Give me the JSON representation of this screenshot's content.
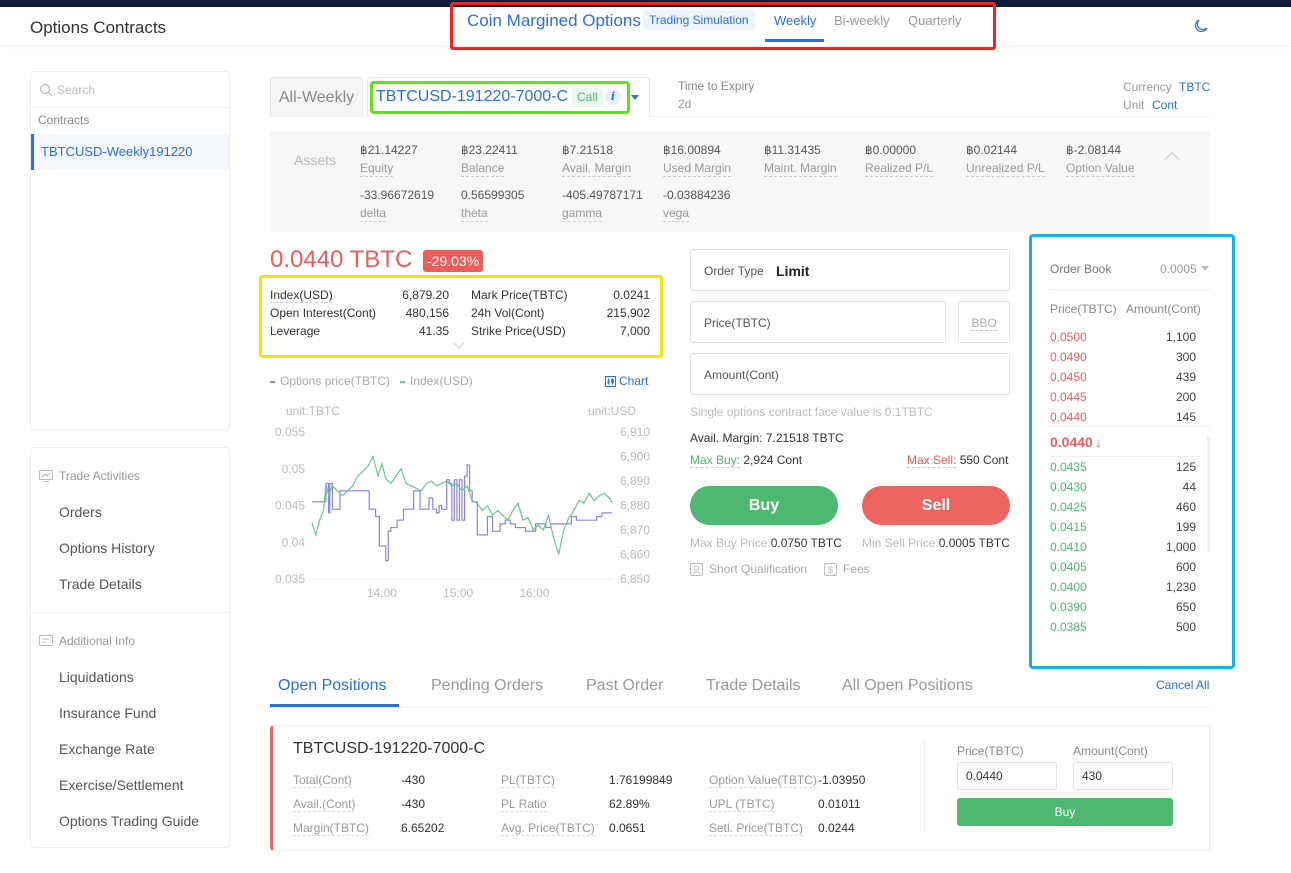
{
  "header": {
    "page_title": "Options Contracts",
    "brand": "Coin Margined Options",
    "badge": "Trading Simulation",
    "tabs": [
      {
        "label": "Weekly",
        "active": true
      },
      {
        "label": "Bi-weekly",
        "active": false
      },
      {
        "label": "Quarterly",
        "active": false
      }
    ],
    "theme_icon": "moon-icon"
  },
  "sidebar": {
    "search_placeholder": "Search",
    "contracts_label": "Contracts",
    "contracts": [
      "TBTCUSD-Weekly191220"
    ],
    "trade_activities": {
      "title": "Trade Activities",
      "items": [
        "Orders",
        "Options History",
        "Trade Details"
      ]
    },
    "additional_info": {
      "title": "Additional Info",
      "items": [
        "Liquidations",
        "Insurance Fund",
        "Exchange Rate",
        "Exercise/Settlement",
        "Options Trading Guide"
      ]
    }
  },
  "selector": {
    "all_tab": "All-Weekly",
    "contract": "TBTCUSD-191220-7000-C",
    "type_badge": "Call",
    "info_icon": "i",
    "time_to_expiry_label": "Time to Expiry",
    "time_to_expiry": "2d",
    "currency_label": "Currency",
    "currency": "TBTC",
    "unit_label": "Unit",
    "unit": "Cont"
  },
  "assets": {
    "title": "Assets",
    "row1": [
      {
        "value": "฿21.14227",
        "label": "Equity"
      },
      {
        "value": "฿23.22411",
        "label": "Balance"
      },
      {
        "value": "฿7.21518",
        "label": "Avail. Margin"
      },
      {
        "value": "฿16.00894",
        "label": "Used Margin"
      },
      {
        "value": "฿11.31435",
        "label": "Maint. Margin"
      },
      {
        "value": "฿0.00000",
        "label": "Realized P/L"
      },
      {
        "value": "฿0.02144",
        "label": "Unrealized P/L"
      },
      {
        "value": "฿-2.08144",
        "label": "Option Value"
      }
    ],
    "row2": [
      {
        "value": "-33.96672619",
        "label": "delta"
      },
      {
        "value": "0.56599305",
        "label": "theta"
      },
      {
        "value": "-405.49787171",
        "label": "gamma"
      },
      {
        "value": "-0.03884236",
        "label": "vega"
      }
    ]
  },
  "ticker": {
    "last_price": "0.0440 TBTC",
    "change": "-29.03%",
    "stats_left": [
      {
        "label": "Index(USD)",
        "value": "6,879.20"
      },
      {
        "label": "Open Interest(Cont)",
        "value": "480,156"
      },
      {
        "label": "Leverage",
        "value": "41.35"
      }
    ],
    "stats_right": [
      {
        "label": "Mark Price(TBTC)",
        "value": "0.0241"
      },
      {
        "label": "24h Vol(Cont)",
        "value": "215,902"
      },
      {
        "label": "Strike Price(USD)",
        "value": "7,000"
      }
    ]
  },
  "chart_link": "Chart",
  "chart_data": {
    "type": "line",
    "title": "",
    "legend": [
      "Options price(TBTC)",
      "Index(USD)"
    ],
    "legend_position": "top-left",
    "left_unit": "unit:TBTC",
    "right_unit": "unit:USD",
    "x_ticks": [
      "14:00",
      "15:00",
      "16:00"
    ],
    "x_range": [
      "13:05",
      "17:00"
    ],
    "y_left_ticks": [
      "0.055",
      "0.05",
      "0.045",
      "0.04",
      "0.035"
    ],
    "y_left_range": [
      0.035,
      0.055
    ],
    "y_right_ticks": [
      "6,910",
      "6,900",
      "6,890",
      "6,880",
      "6,870",
      "6,860",
      "6,850"
    ],
    "y_right_range": [
      6850,
      6910
    ],
    "colors": {
      "options": "#8b85e0",
      "index": "#6cc68a"
    },
    "series": [
      {
        "name": "Options price(TBTC)",
        "axis": "left",
        "x_min": [
          0,
          9,
          11,
          12,
          13,
          14,
          16,
          18,
          22,
          25,
          30,
          40,
          45,
          50,
          53,
          58,
          60,
          62,
          65,
          67,
          70,
          72,
          76,
          80,
          85,
          88,
          92,
          95,
          98,
          100,
          102,
          104,
          106,
          108,
          110,
          112,
          114,
          116,
          118,
          120,
          122,
          124,
          126,
          130,
          134,
          138,
          142,
          144,
          148,
          152,
          156,
          160,
          164,
          168,
          172,
          176,
          180,
          184,
          188,
          192,
          196,
          200,
          204,
          208,
          212,
          216,
          220,
          224,
          228,
          232,
          236
        ],
        "values": [
          0.0455,
          0.0455,
          0.048,
          0.048,
          0.044,
          0.048,
          0.0445,
          0.0445,
          0.047,
          0.047,
          0.047,
          0.047,
          0.0445,
          0.0435,
          0.0395,
          0.0375,
          0.0415,
          0.042,
          0.042,
          0.043,
          0.043,
          0.0445,
          0.0445,
          0.047,
          0.0445,
          0.0445,
          0.046,
          0.0445,
          0.044,
          0.045,
          0.0445,
          0.0445,
          0.0485,
          0.048,
          0.043,
          0.0485,
          0.043,
          0.0485,
          0.043,
          0.049,
          0.0505,
          0.047,
          0.0455,
          0.041,
          0.041,
          0.0435,
          0.0415,
          0.0415,
          0.0425,
          0.043,
          0.0425,
          0.042,
          0.042,
          0.0415,
          0.0415,
          0.0425,
          0.0425,
          0.042,
          0.0425,
          0.0425,
          0.0425,
          0.0425,
          0.0435,
          0.043,
          0.043,
          0.043,
          0.043,
          0.0435,
          0.044,
          0.044,
          0.044
        ]
      },
      {
        "name": "Index(USD)",
        "axis": "right",
        "x_min": [
          0,
          3,
          6,
          9,
          11,
          13,
          16,
          20,
          24,
          28,
          32,
          36,
          40,
          44,
          48,
          52,
          55,
          58,
          62,
          66,
          70,
          74,
          78,
          82,
          86,
          90,
          94,
          98,
          102,
          106,
          110,
          114,
          118,
          122,
          126,
          130,
          134,
          138,
          142,
          146,
          150,
          154,
          158,
          162,
          166,
          170,
          174,
          178,
          182,
          186,
          190,
          194,
          198,
          202,
          206,
          210,
          214,
          218,
          222,
          226,
          230,
          234,
          236
        ],
        "values": [
          6873,
          6868,
          6874,
          6878,
          6889,
          6884,
          6888,
          6886,
          6884,
          6886,
          6888,
          6892,
          6894,
          6896,
          6900,
          6892,
          6897,
          6891,
          6889,
          6892,
          6895,
          6889,
          6888,
          6887,
          6886,
          6889,
          6890,
          6888,
          6889,
          6890,
          6888,
          6889,
          6886,
          6888,
          6882,
          6881,
          6878,
          6880,
          6876,
          6878,
          6876,
          6874,
          6878,
          6881,
          6874,
          6875,
          6870,
          6872,
          6870,
          6876,
          6867,
          6860,
          6870,
          6875,
          6878,
          6882,
          6881,
          6885,
          6882,
          6884,
          6885,
          6883,
          6881
        ]
      }
    ]
  },
  "order_form": {
    "order_type_label": "Order Type",
    "order_type": "Limit",
    "price_label": "Price(TBTC)",
    "price_value": "",
    "bbo": "BBO",
    "amount_label": "Amount(Cont)",
    "amount_value": "",
    "hint": "Single options contract face value is 0.1TBTC",
    "avail_margin": "Avail. Margin: 7.21518 TBTC",
    "max_buy_label": "Max Buy:",
    "max_buy": "2,924 Cont",
    "max_sell_label": "Max Sell:",
    "max_sell": "550 Cont",
    "buy": "Buy",
    "sell": "Sell",
    "max_buy_price_label": "Max Buy Price",
    "max_buy_price": "0.0750 TBTC",
    "min_sell_price_label": "Min Sell Price",
    "min_sell_price": "0.0005 TBTC",
    "short_qualification": "Short Qualification",
    "fees": "Fees"
  },
  "order_book": {
    "title": "Order Book",
    "step": "0.0005",
    "price_header": "Price(TBTC)",
    "amount_header": "Amount(Cont)",
    "asks": [
      {
        "price": "0.0500",
        "amount": "1,100"
      },
      {
        "price": "0.0490",
        "amount": "300"
      },
      {
        "price": "0.0450",
        "amount": "439"
      },
      {
        "price": "0.0445",
        "amount": "200"
      },
      {
        "price": "0.0440",
        "amount": "145"
      }
    ],
    "last": "0.0440",
    "last_direction": "↓",
    "bids": [
      {
        "price": "0.0435",
        "amount": "125"
      },
      {
        "price": "0.0430",
        "amount": "44"
      },
      {
        "price": "0.0425",
        "amount": "460"
      },
      {
        "price": "0.0415",
        "amount": "199"
      },
      {
        "price": "0.0410",
        "amount": "1,000"
      },
      {
        "price": "0.0405",
        "amount": "600"
      },
      {
        "price": "0.0400",
        "amount": "1,230"
      },
      {
        "price": "0.0390",
        "amount": "650"
      },
      {
        "price": "0.0385",
        "amount": "500"
      }
    ]
  },
  "bottom": {
    "tabs": [
      {
        "label": "Open Positions",
        "active": true
      },
      {
        "label": "Pending Orders",
        "active": false
      },
      {
        "label": "Past Order",
        "active": false
      },
      {
        "label": "Trade Details",
        "active": false
      },
      {
        "label": "All Open Positions",
        "active": false
      }
    ],
    "cancel_all": "Cancel All",
    "position": {
      "contract": "TBTCUSD-191220-7000-C",
      "fields": [
        {
          "label": "Total(Cont)",
          "value": "-430"
        },
        {
          "label": "Avail.(Cont)",
          "value": "-430"
        },
        {
          "label": "Margin(TBTC)",
          "value": "6.65202"
        },
        {
          "label": "PL(TBTC)",
          "value": "1.76199849"
        },
        {
          "label": "PL Ratio",
          "value": "62.89%"
        },
        {
          "label": "Avg. Price(TBTC)",
          "value": "0.0651"
        },
        {
          "label": "Option Value(TBTC)",
          "value": "-1.03950"
        },
        {
          "label": "UPL (TBTC)",
          "value": "0.01011"
        },
        {
          "label": "Setl. Price(TBTC)",
          "value": "0.0244"
        }
      ],
      "close_price_label": "Price(TBTC)",
      "close_price": "0.0440",
      "close_amount_label": "Amount(Cont)",
      "close_amount": "430",
      "close_button": "Buy"
    }
  }
}
